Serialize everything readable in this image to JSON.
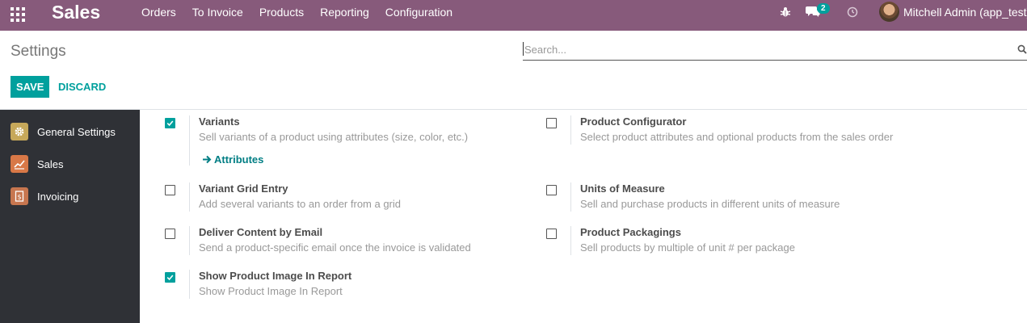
{
  "navbar": {
    "app_title": "Sales",
    "menu": [
      {
        "label": "Orders"
      },
      {
        "label": "To Invoice"
      },
      {
        "label": "Products"
      },
      {
        "label": "Reporting"
      },
      {
        "label": "Configuration"
      }
    ],
    "chat_count": "2",
    "user_name": "Mitchell Admin (app_test)",
    "bg_color": "#875a7b"
  },
  "control_panel": {
    "breadcrumb": "Settings",
    "search_placeholder": "Search...",
    "save_label": "SAVE",
    "discard_label": "DISCARD",
    "accent_color": "#00a09d"
  },
  "sidebar": {
    "items": [
      {
        "label": "General Settings",
        "icon": "gear-icon"
      },
      {
        "label": "Sales",
        "icon": "chart-line-icon"
      },
      {
        "label": "Invoicing",
        "icon": "invoice-icon"
      }
    ]
  },
  "settings": {
    "variants": {
      "title": "Variants",
      "desc": "Sell variants of a product using attributes (size, color, etc.)",
      "checked": true,
      "link": "Attributes"
    },
    "product_configurator": {
      "title": "Product Configurator",
      "desc": "Select product attributes and optional products from the sales order",
      "checked": false
    },
    "variant_grid": {
      "title": "Variant Grid Entry",
      "desc": "Add several variants to an order from a grid",
      "checked": false
    },
    "units_of_measure": {
      "title": "Units of Measure",
      "desc": "Sell and purchase products in different units of measure",
      "checked": false
    },
    "deliver_email": {
      "title": "Deliver Content by Email",
      "desc": "Send a product-specific email once the invoice is validated",
      "checked": false
    },
    "product_packagings": {
      "title": "Product Packagings",
      "desc": "Sell products by multiple of unit # per package",
      "checked": false
    },
    "show_image": {
      "title": "Show Product Image In Report",
      "desc": "Show Product Image In Report",
      "checked": true
    }
  }
}
